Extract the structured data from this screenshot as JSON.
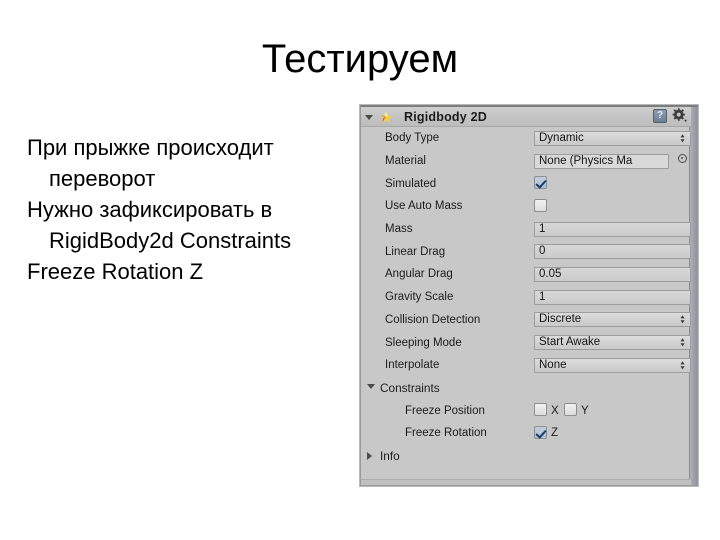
{
  "slide": {
    "title": "Тестируем",
    "body_lines": [
      "При прыжке происходит переворот",
      "Нужно зафиксировать в RigidBody2d Constraints",
      "Freeze Rotation Z"
    ]
  },
  "inspector": {
    "component_title": "Rigidbody 2D",
    "icons": {
      "foldout": "triangle-down-icon",
      "physics": "physics-2d-icon",
      "help": "?",
      "gear": "gear-icon"
    },
    "rows": [
      {
        "label": "Body Type",
        "kind": "popup",
        "value": "Dynamic"
      },
      {
        "label": "Material",
        "kind": "object",
        "value": "None (Physics Ma"
      },
      {
        "label": "Simulated",
        "kind": "checkbox",
        "value": "checked"
      },
      {
        "label": "Use Auto Mass",
        "kind": "checkbox",
        "value": "unchecked"
      },
      {
        "label": "Mass",
        "kind": "number",
        "value": "1"
      },
      {
        "label": "Linear Drag",
        "kind": "number",
        "value": "0"
      },
      {
        "label": "Angular Drag",
        "kind": "number",
        "value": "0.05"
      },
      {
        "label": "Gravity Scale",
        "kind": "number",
        "value": "1"
      },
      {
        "label": "Collision Detection",
        "kind": "popup",
        "value": "Discrete"
      },
      {
        "label": "Sleeping Mode",
        "kind": "popup",
        "value": "Start Awake"
      },
      {
        "label": "Interpolate",
        "kind": "popup",
        "value": "None"
      }
    ],
    "constraints": {
      "section_label": "Constraints",
      "freeze_position": {
        "label": "Freeze Position",
        "x_label": "X",
        "x_checked": "unchecked",
        "y_label": "Y",
        "y_checked": "unchecked"
      },
      "freeze_rotation": {
        "label": "Freeze Rotation",
        "z_label": "Z",
        "z_checked": "checked"
      }
    },
    "info": {
      "label": "Info"
    }
  },
  "colors": {
    "panel_bg": "#c8c8c8",
    "header_bg": "#c4c4c4",
    "field_bg": "#d2d2d2",
    "checkbox_on": "#aebdd3",
    "check_mark": "#1b3c6b",
    "text": "#1b1b1b"
  }
}
